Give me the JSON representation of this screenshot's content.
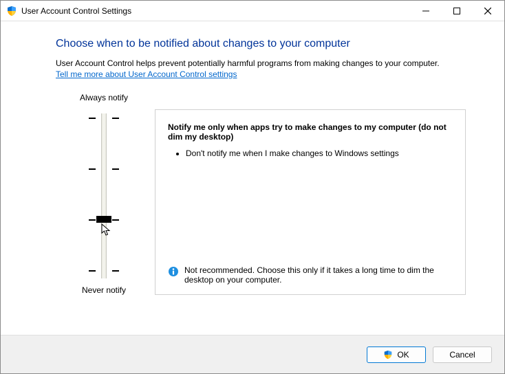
{
  "titlebar": {
    "title": "User Account Control Settings"
  },
  "content": {
    "heading": "Choose when to be notified about changes to your computer",
    "description": "User Account Control helps prevent potentially harmful programs from making changes to your computer.",
    "link_text": "Tell me more about User Account Control settings"
  },
  "slider": {
    "top_label": "Always notify",
    "bottom_label": "Never notify",
    "levels": 4,
    "current_level": 2
  },
  "panel": {
    "title": "Notify me only when apps try to make changes to my computer (do not dim my desktop)",
    "bullets": [
      "Don't notify me when I make changes to Windows settings"
    ],
    "warning": "Not recommended. Choose this only if it takes a long time to dim the desktop on your computer."
  },
  "footer": {
    "ok_label": "OK",
    "cancel_label": "Cancel"
  }
}
